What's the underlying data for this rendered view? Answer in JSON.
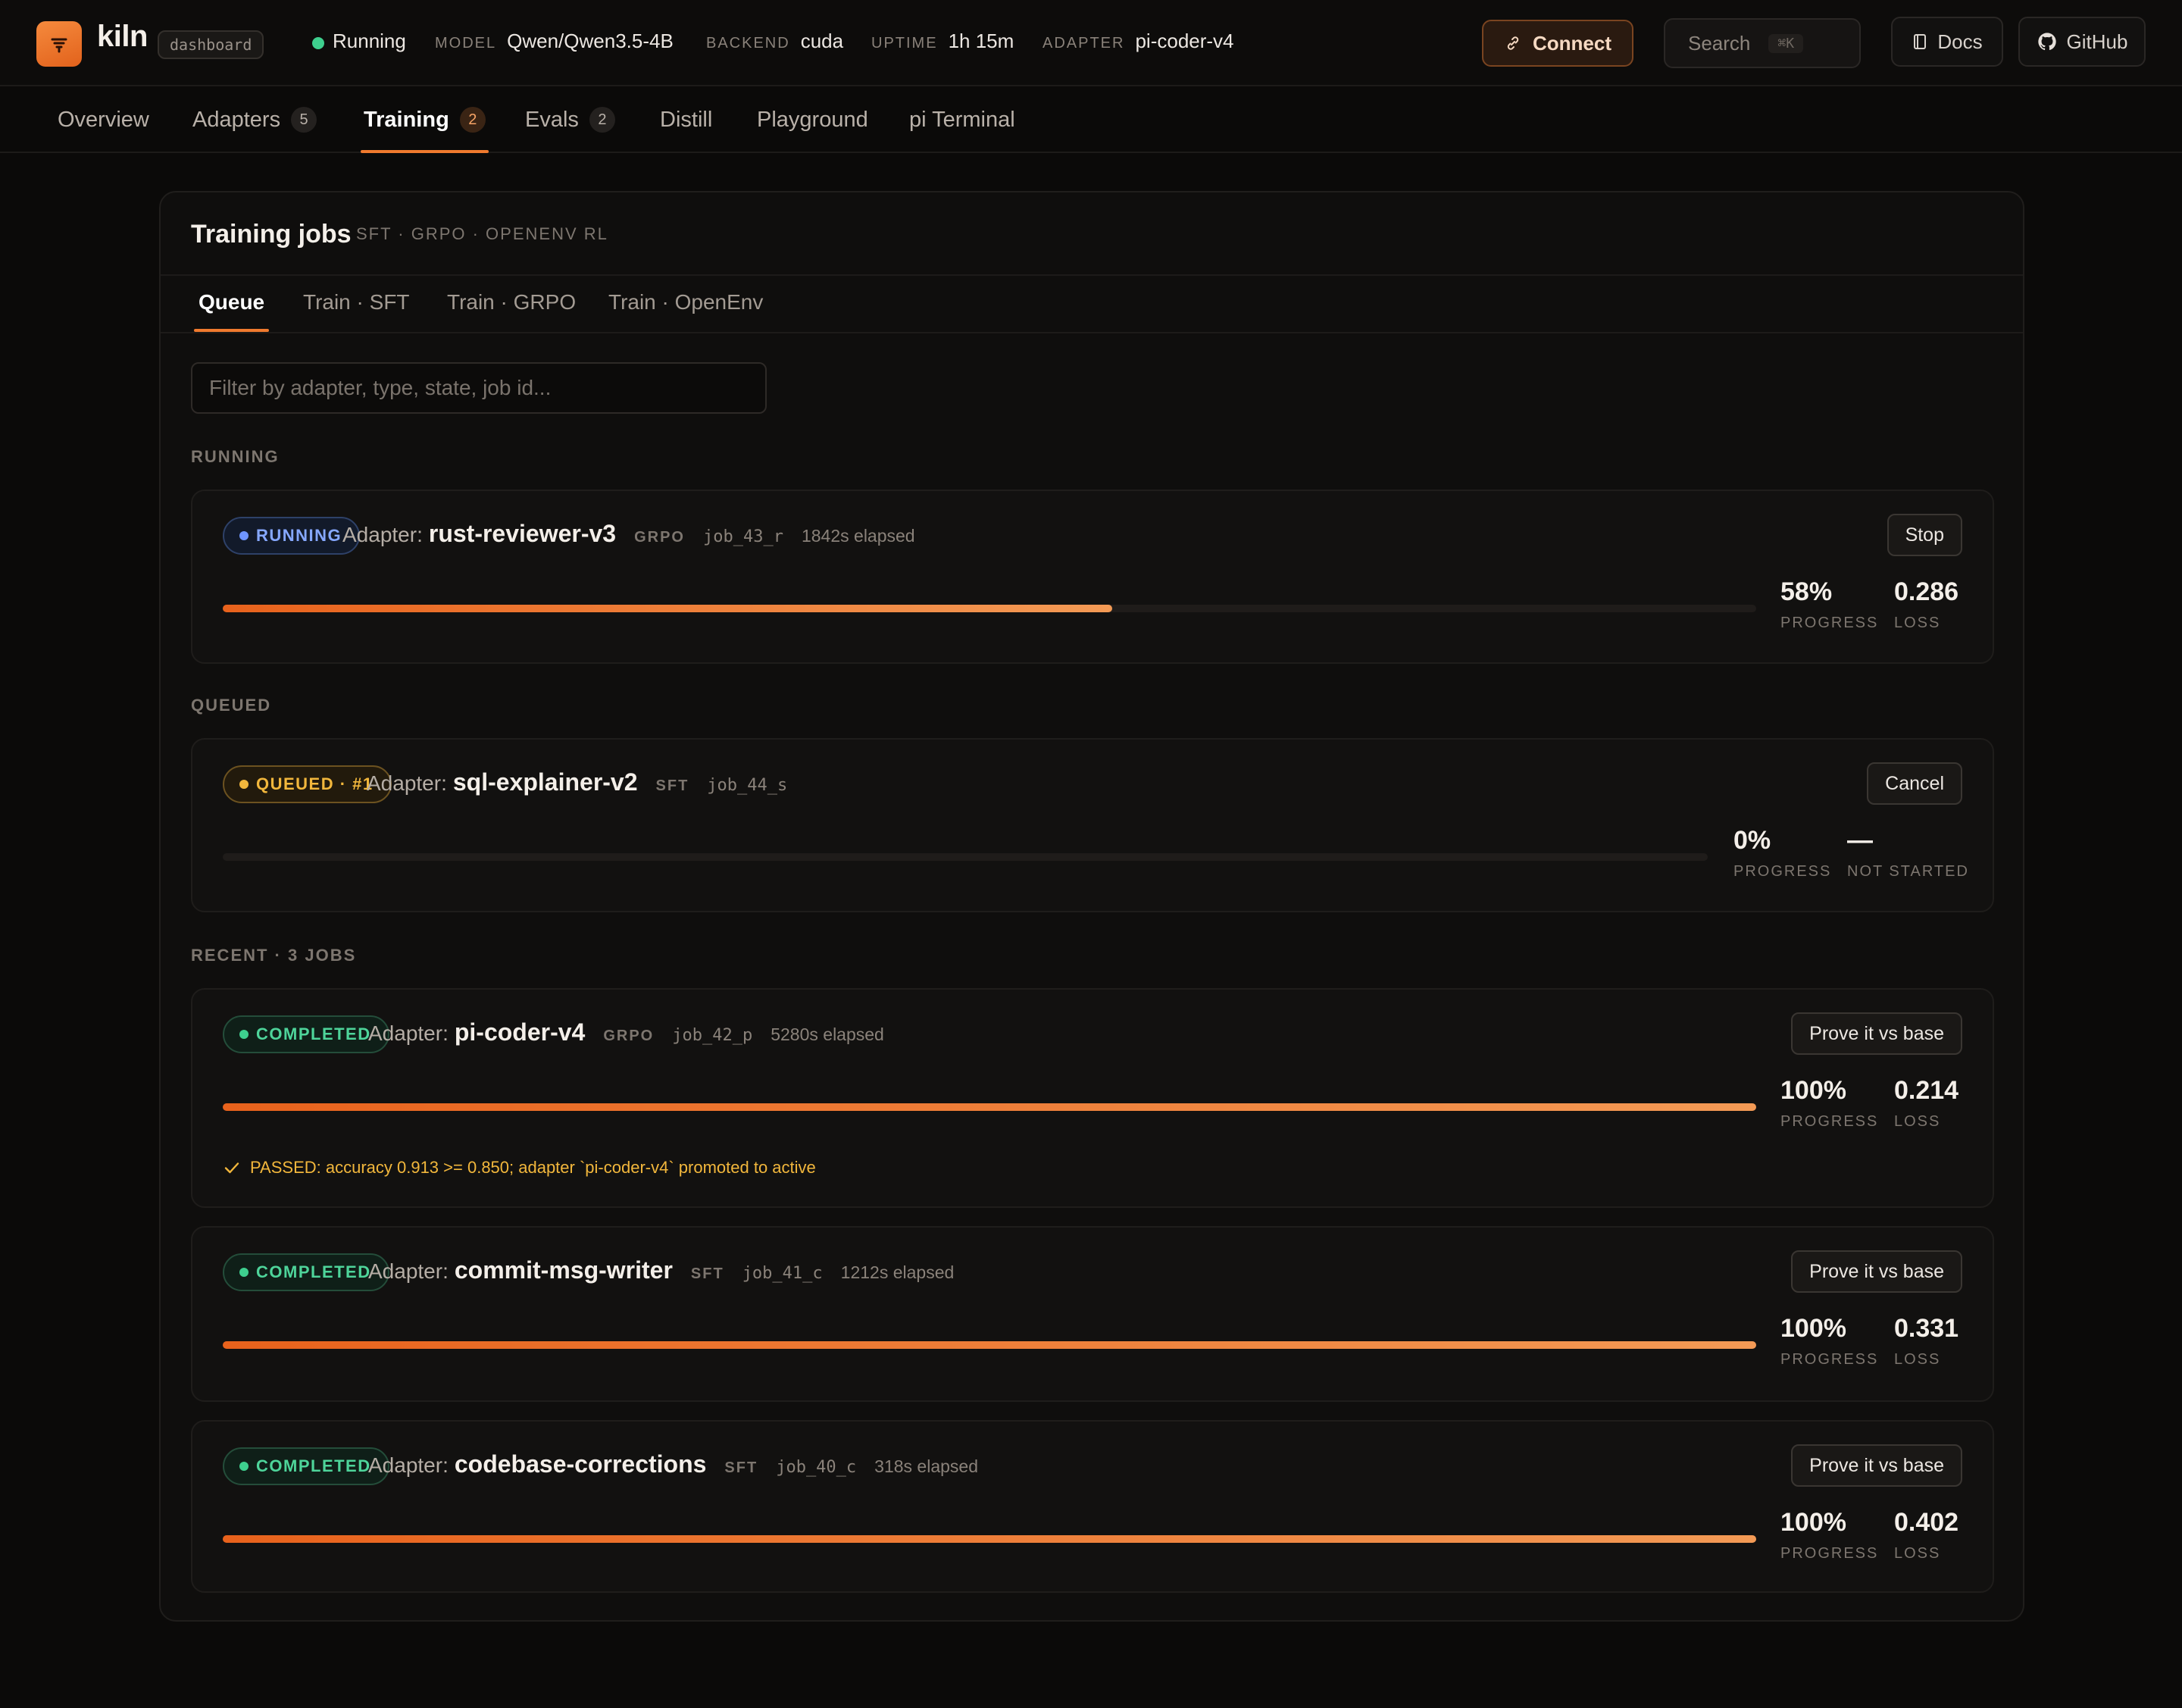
{
  "app": {
    "name": "kiln",
    "tag": "dashboard"
  },
  "status": {
    "label": "Running",
    "color": "#3ecf8e"
  },
  "meta": {
    "model": {
      "key": "MODEL",
      "value": "Qwen/Qwen3.5-4B"
    },
    "backend": {
      "key": "BACKEND",
      "value": "cuda"
    },
    "uptime": {
      "key": "UPTIME",
      "value": "1h 15m"
    },
    "adapter": {
      "key": "ADAPTER",
      "value": "pi-coder-v4"
    }
  },
  "header": {
    "connect_label": "Connect",
    "search_label": "Search",
    "search_shortcut": "⌘K",
    "docs_label": "Docs",
    "github_label": "GitHub"
  },
  "nav": {
    "items": [
      {
        "label": "Overview",
        "count": ""
      },
      {
        "label": "Adapters",
        "count": "5"
      },
      {
        "label": "Training",
        "count": "2",
        "active": true
      },
      {
        "label": "Evals",
        "count": "2"
      },
      {
        "label": "Distill",
        "count": ""
      },
      {
        "label": "Playground",
        "count": ""
      },
      {
        "label": "pi Terminal",
        "count": ""
      }
    ]
  },
  "training": {
    "title": "Training jobs",
    "subtitle": "SFT · GRPO · OPENENV RL",
    "tabs": [
      "Queue",
      "Train · SFT",
      "Train · GRPO",
      "Train · OpenEnv"
    ],
    "active_tab": "Queue",
    "filter_placeholder": "Filter by adapter, type, state, job id...",
    "sections": {
      "running": "RUNNING",
      "queued": "QUEUED",
      "recent": "RECENT · 3 JOBS"
    },
    "adapter_prefix": "Adapter:",
    "progress_label": "PROGRESS",
    "loss_label": "LOSS",
    "running_job": {
      "status": "RUNNING",
      "adapter": "rust-reviewer-v3",
      "type": "GRPO",
      "job_id": "job_43_r",
      "elapsed": "1842s elapsed",
      "progress_value": 0.58,
      "progress": "58%",
      "loss": "0.286",
      "action": "Stop"
    },
    "queued_job": {
      "status": "QUEUED · #1",
      "adapter": "sql-explainer-v2",
      "type": "SFT",
      "job_id": "job_44_s",
      "progress_value": 0,
      "progress": "0%",
      "loss": "—",
      "loss_label": "NOT STARTED",
      "action": "Cancel"
    },
    "recent_jobs": [
      {
        "status": "COMPLETED",
        "adapter": "pi-coder-v4",
        "type": "GRPO",
        "job_id": "job_42_p",
        "elapsed": "5280s elapsed",
        "progress_value": 1.0,
        "progress": "100%",
        "loss": "0.214",
        "action": "Prove it vs base",
        "note": "PASSED: accuracy 0.913 >= 0.850; adapter `pi-coder-v4` promoted to active"
      },
      {
        "status": "COMPLETED",
        "adapter": "commit-msg-writer",
        "type": "SFT",
        "job_id": "job_41_c",
        "elapsed": "1212s elapsed",
        "progress_value": 1.0,
        "progress": "100%",
        "loss": "0.331",
        "action": "Prove it vs base"
      },
      {
        "status": "COMPLETED",
        "adapter": "codebase-corrections",
        "type": "SFT",
        "job_id": "job_40_c",
        "elapsed": "318s elapsed",
        "progress_value": 1.0,
        "progress": "100%",
        "loss": "0.402",
        "action": "Prove it vs base"
      }
    ]
  },
  "colors": {
    "accent": "#f07a2e",
    "running": "#6f95ff",
    "queued": "#f2b73c",
    "completed": "#3ecf8e"
  },
  "icons": {
    "logo": "kiln-logo-icon",
    "connect": "link-icon",
    "docs": "book-icon",
    "github": "github-icon",
    "check": "check-icon"
  }
}
